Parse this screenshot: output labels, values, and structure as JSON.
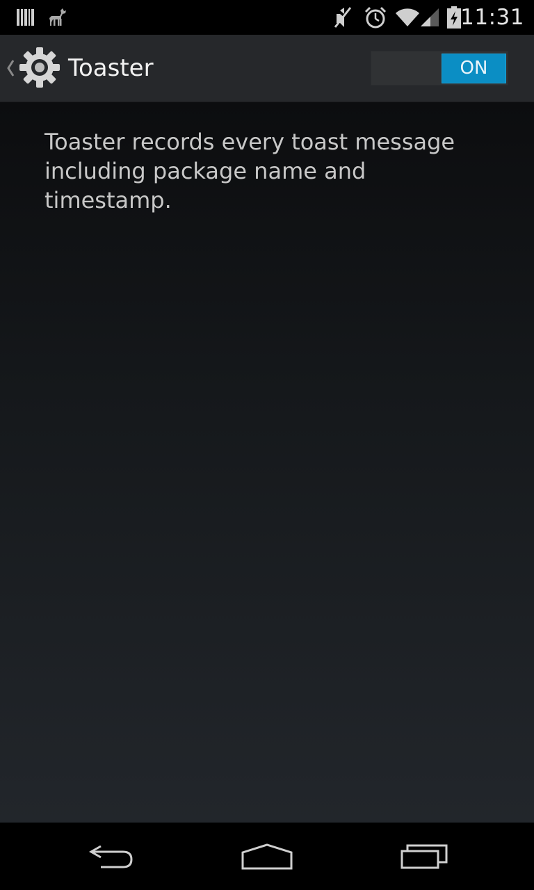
{
  "status_bar": {
    "time": "11:31",
    "icons": [
      "barcode-icon",
      "deer-icon",
      "mute-icon",
      "alarm-icon",
      "wifi-icon",
      "signal-icon",
      "battery-charging-icon"
    ]
  },
  "action_bar": {
    "title": "Toaster",
    "up_icon": "chevron-left-icon",
    "app_icon": "gear-icon",
    "switch": {
      "label": "ON",
      "state": "on",
      "accent_color": "#0b8ec4"
    }
  },
  "content": {
    "description": "Toaster records every toast message including package name and timestamp."
  },
  "nav_bar": {
    "buttons": [
      "back-icon",
      "home-icon",
      "recents-icon"
    ]
  }
}
